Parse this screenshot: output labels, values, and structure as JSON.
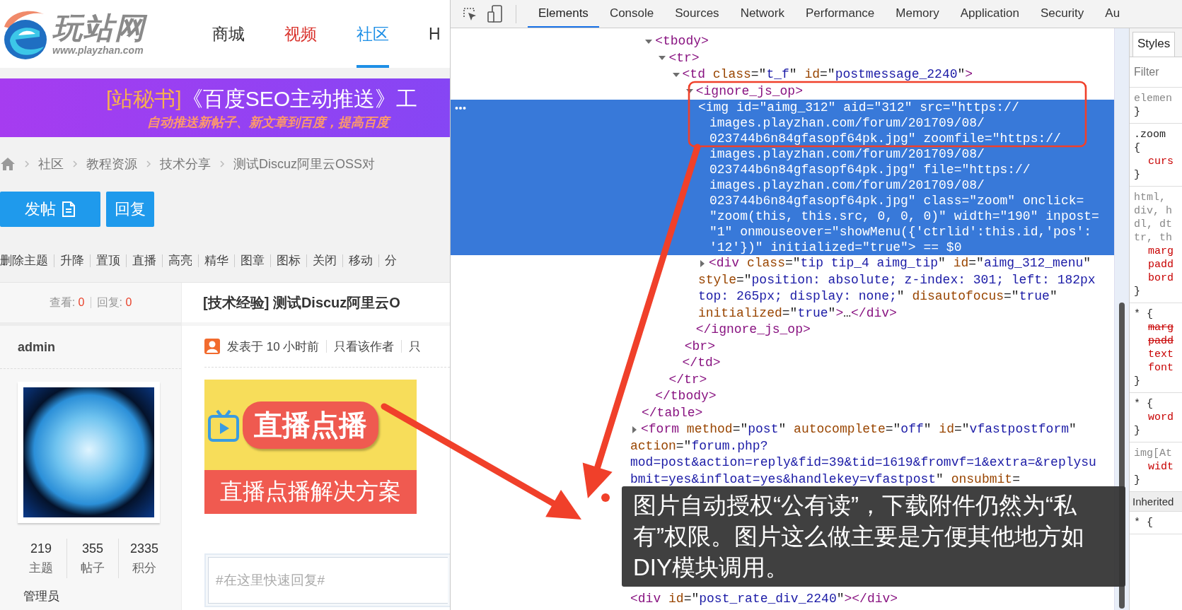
{
  "page": {
    "logo": {
      "text": "玩站网",
      "url": "www.playzhan.com"
    },
    "nav": [
      {
        "label": "商城",
        "selected": false,
        "color": "#333333"
      },
      {
        "label": "视频",
        "selected": false,
        "color": "#d9322c"
      },
      {
        "label": "社区",
        "selected": true,
        "color": "#1e8fe6"
      },
      {
        "label": "H",
        "selected": false,
        "color": "#333333"
      }
    ],
    "banner": {
      "tag": "[站秘书]",
      "title": "《百度SEO主动推送》工",
      "subtitle": "自动推送新帖子、新文章到百度，提高百度"
    },
    "breadcrumb": [
      "社区",
      "教程资源",
      "技术分享",
      "测试Discuz阿里云OSS对"
    ],
    "buttons": [
      {
        "label": "发帖",
        "kind": "post"
      },
      {
        "label": "回复",
        "kind": "reply"
      }
    ],
    "moderation": [
      "删除主题",
      "升降",
      "置顶",
      "直播",
      "高亮",
      "精华",
      "图章",
      "图标",
      "关闭",
      "移动",
      "分"
    ],
    "thread": {
      "views_label": "查看:",
      "views": "0",
      "replies_label": "回复:",
      "replies": "0",
      "title": "[技术经验] 测试Discuz阿里云O"
    },
    "author": {
      "name": "admin",
      "stats": [
        {
          "value": "219",
          "label": "主题"
        },
        {
          "value": "355",
          "label": "帖子"
        },
        {
          "value": "2335",
          "label": "积分"
        }
      ],
      "group": "管理员"
    },
    "post": {
      "time": "发表于 10 小时前",
      "links": [
        "只看该作者",
        "只"
      ],
      "image": {
        "badge": "直播点播",
        "caption": "直播点播解决方案"
      }
    },
    "reply": {
      "placeholder": "#在这里快速回复#"
    }
  },
  "devtools": {
    "tabs": [
      {
        "label": "Elements",
        "selected": true
      },
      {
        "label": "Console",
        "selected": false
      },
      {
        "label": "Sources",
        "selected": false
      },
      {
        "label": "Network",
        "selected": false
      },
      {
        "label": "Performance",
        "selected": false
      },
      {
        "label": "Memory",
        "selected": false
      },
      {
        "label": "Application",
        "selected": false
      },
      {
        "label": "Security",
        "selected": false
      },
      {
        "label": "Au",
        "selected": false
      }
    ],
    "dom": [
      {
        "close": "</table>",
        "selected": false,
        "children": [
          {
            "lines": [
              "<tbody>"
            ],
            "expanded": true,
            "selected": false,
            "close": "</tbody>",
            "children": [
              {
                "lines": [
                  "<tr>"
                ],
                "expanded": true,
                "selected": false,
                "close": "</tr>",
                "children": [
                  {
                    "lines": [
                      "<td class=\"t_f\" id=\"postmessage_2240\">"
                    ],
                    "expanded": true,
                    "selected": false,
                    "close": "</td>",
                    "children": [
                      {
                        "lines": [
                          "<ignore_js_op>"
                        ],
                        "expanded": true,
                        "selected": false,
                        "close": "</ignore_js_op>",
                        "children": [
                          {
                            "lines": [
                              "<img id=\"aimg_312\" aid=\"312\" src=\"https://",
                              "images.playzhan.com/forum/201709/08/",
                              "023744b6n84gfasopf64pk.jpg\" zoomfile=\"https://",
                              "images.playzhan.com/forum/201709/08/",
                              "023744b6n84gfasopf64pk.jpg\" file=\"https://",
                              "images.playzhan.com/forum/201709/08/",
                              "023744b6n84gfasopf64pk.jpg\" class=\"zoom\" onclick=",
                              "\"zoom(this, this.src, 0, 0, 0)\" width=\"190\" inpost=",
                              "\"1\" onmouseover=\"showMenu({'ctrlid':this.id,'pos':",
                              "'12'})\" initialized=\"true\"> == $0"
                            ],
                            "selected": true
                          },
                          {
                            "lines": [
                              "<div class=\"tip tip_4 aimg_tip\" id=\"aimg_312_menu\"",
                              "style=\"position: absolute; z-index: 301; left: 182px",
                              "top: 265px; display: none;\" disautofocus=\"true\"",
                              "initialized=\"true\">…</div>"
                            ],
                            "expanded": false,
                            "selected": false
                          }
                        ]
                      },
                      {
                        "lines": [
                          "<br>"
                        ],
                        "selected": false
                      }
                    ]
                  }
                ]
              }
            ]
          }
        ]
      },
      {
        "lines": [
          "<form method=\"post\" autocomplete=\"off\" id=\"vfastpostform\"",
          "action=\"forum.php?",
          "mod=post&action=reply&fid=39&tid=1619&fromvf=1&extra=&replysu",
          "bmit=yes&infloat=yes&handlekey=vfastpost\" onsubmit="
        ],
        "expanded": false,
        "selected": false
      },
      {
        "lines": [
          "<div id=\"post_rate_div_2240\"></div>"
        ],
        "selected": false
      }
    ],
    "styles": {
      "tab": "Styles",
      "filter_placeholder": "Filter",
      "rules": [
        {
          "kind": "rule",
          "lines": [
            {
              "kind": "selector-dim",
              "text": "elemen"
            },
            {
              "kind": "brace",
              "text": "}"
            }
          ]
        },
        {
          "kind": "rule",
          "lines": [
            {
              "kind": "selector",
              "text": ".zoom"
            },
            {
              "kind": "brace",
              "text": "{"
            },
            {
              "kind": "property",
              "text": "curs",
              "overridden": false
            },
            {
              "kind": "brace",
              "text": "}"
            }
          ]
        },
        {
          "kind": "rule",
          "lines": [
            {
              "kind": "selector-dim",
              "text": "html,"
            },
            {
              "kind": "selector-dim",
              "text": "div, h"
            },
            {
              "kind": "selector-dim",
              "text": "dl, dt"
            },
            {
              "kind": "selector-dim",
              "text": "tr, th"
            },
            {
              "kind": "property",
              "text": "marg",
              "overridden": false
            },
            {
              "kind": "property",
              "text": "padd",
              "overridden": false
            },
            {
              "kind": "property",
              "text": "bord",
              "overridden": false
            },
            {
              "kind": "brace",
              "text": "}"
            }
          ]
        },
        {
          "kind": "rule",
          "lines": [
            {
              "kind": "selector",
              "text": "* {"
            },
            {
              "kind": "property",
              "text": "marg",
              "overridden": true
            },
            {
              "kind": "property",
              "text": "padd",
              "overridden": true
            },
            {
              "kind": "property",
              "text": "text",
              "overridden": false
            },
            {
              "kind": "property",
              "text": "font",
              "overridden": false
            },
            {
              "kind": "brace",
              "text": "}"
            }
          ]
        },
        {
          "kind": "rule",
          "lines": [
            {
              "kind": "selector",
              "text": "* {"
            },
            {
              "kind": "property",
              "text": "word",
              "overridden": false
            },
            {
              "kind": "brace",
              "text": "}"
            }
          ]
        },
        {
          "kind": "rule",
          "lines": [
            {
              "kind": "selector-dim",
              "text": "img[At"
            },
            {
              "kind": "property",
              "text": "widt",
              "overridden": false
            },
            {
              "kind": "brace",
              "text": "}"
            }
          ]
        },
        {
          "kind": "section",
          "lines": [
            {
              "kind": "selector-dim",
              "text": "Inherited"
            }
          ]
        },
        {
          "kind": "rule",
          "lines": [
            {
              "kind": "selector",
              "text": "* {"
            }
          ]
        }
      ]
    }
  },
  "annotation": {
    "caption": "图片自动授权“公有读”，下载附件仍然为“私有”权限。图片这么做主要是方便其他地方如DIY模块调用。"
  }
}
